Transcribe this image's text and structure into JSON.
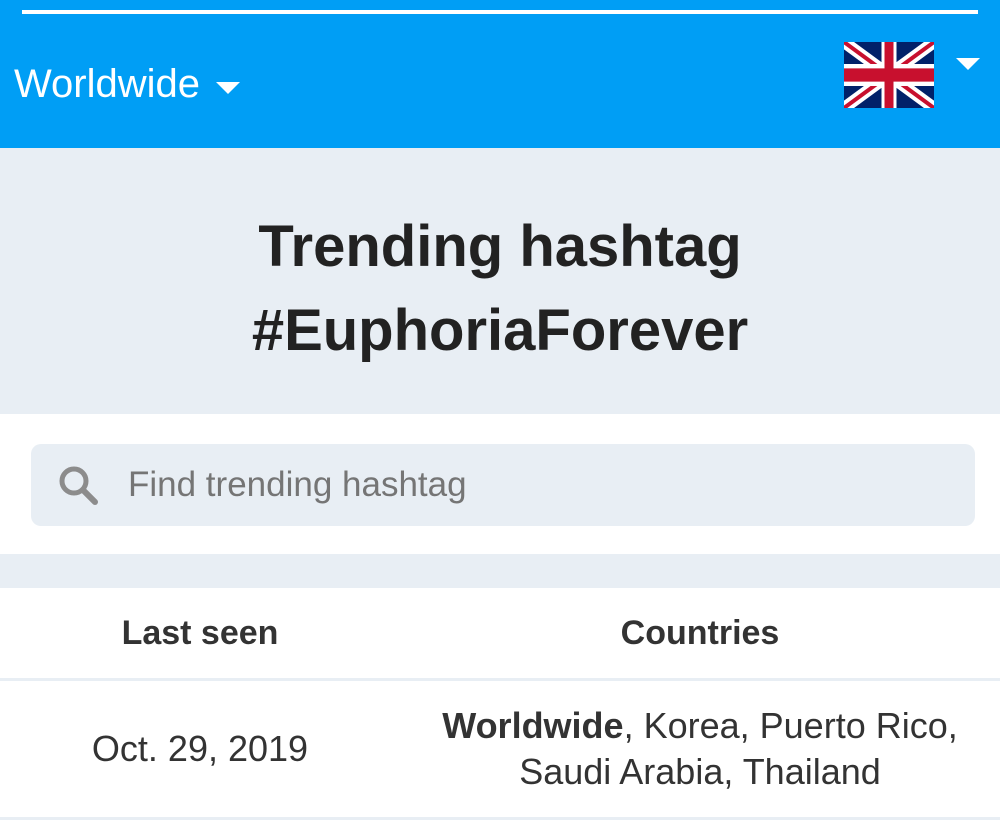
{
  "header": {
    "region_label": "Worldwide",
    "language_flag_icon": "uk-flag-icon",
    "dropdown_icon": "caret-down-icon",
    "background_color": "#009ef5"
  },
  "page": {
    "title_line1": "Trending hashtag",
    "title_line2": "#EuphoriaForever"
  },
  "search": {
    "placeholder": "Find trending hashtag",
    "value": "",
    "icon": "search-icon"
  },
  "table": {
    "headers": [
      "Last seen",
      "Countries"
    ],
    "rows": [
      {
        "last_seen": "Oct. 29, 2019",
        "countries_bold": "Worldwide",
        "countries_line1_rest": ", Korea, Puerto Rico,",
        "countries_line2": "Saudi Arabia, Thailand"
      }
    ]
  }
}
